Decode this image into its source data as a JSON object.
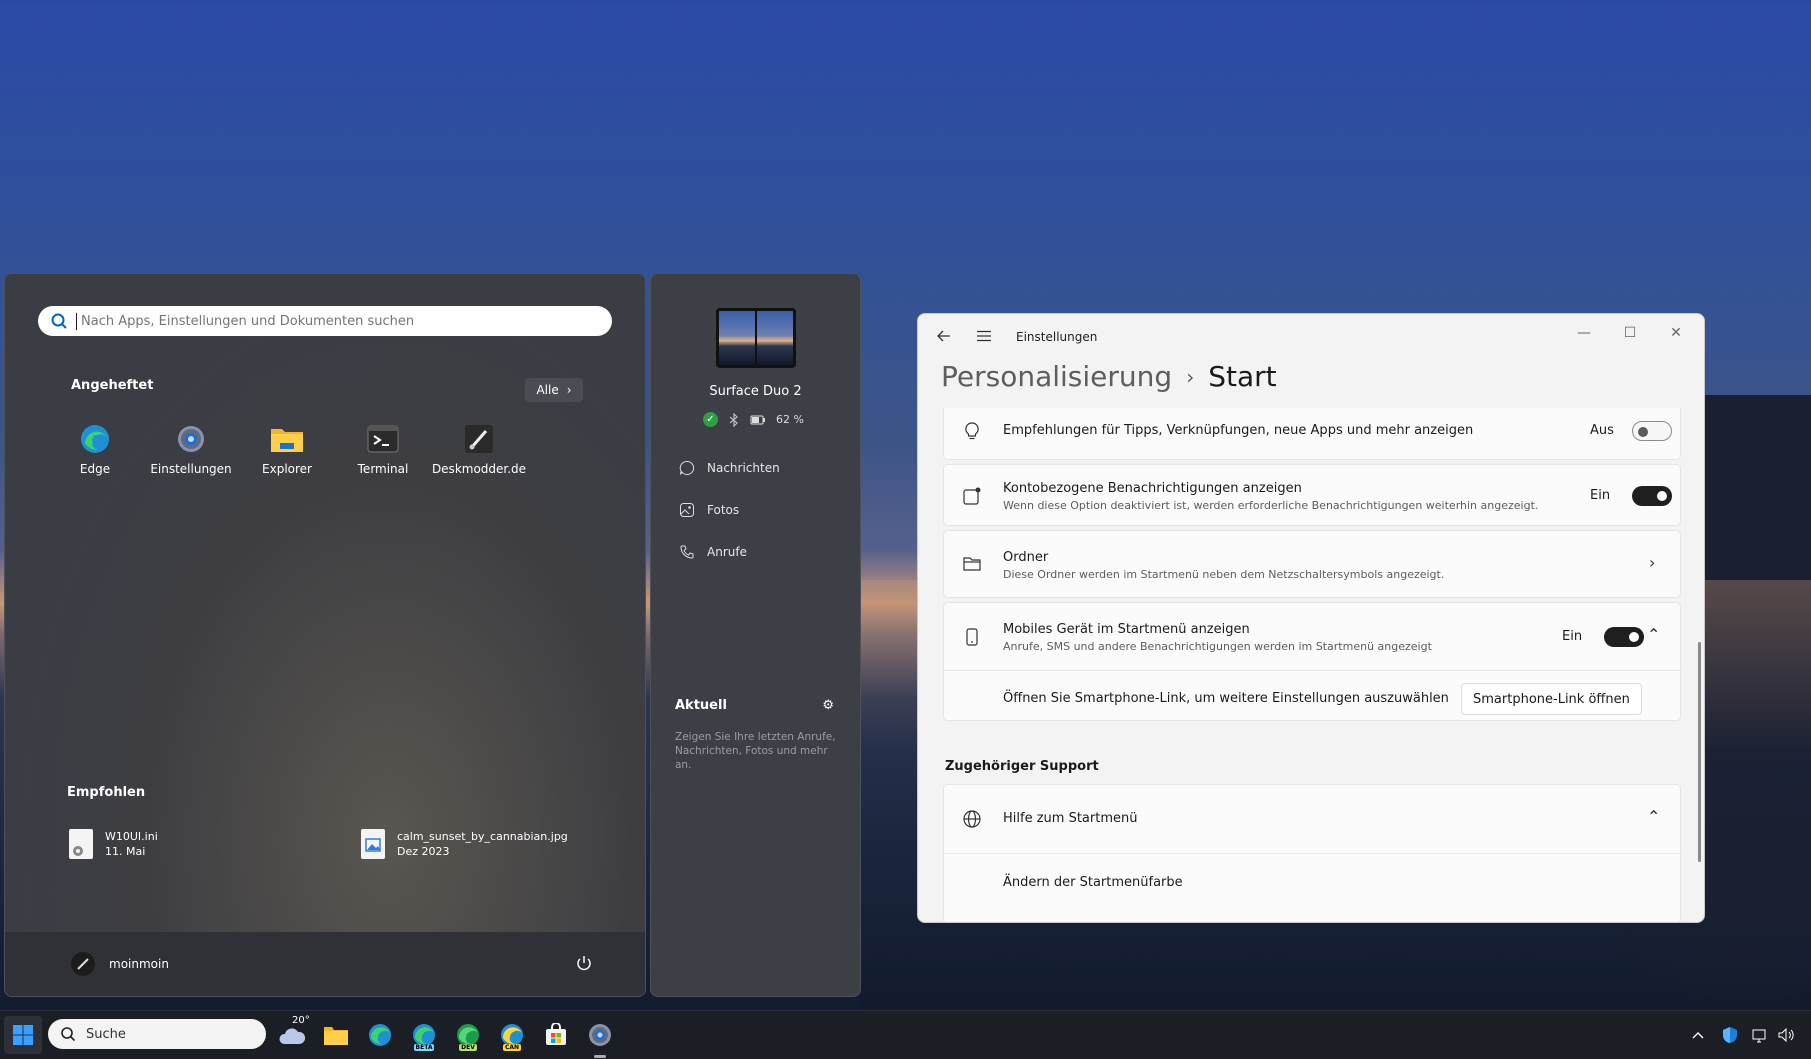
{
  "start_menu": {
    "search_placeholder": "Nach Apps, Einstellungen und Dokumenten suchen",
    "pinned_title": "Angeheftet",
    "all_label": "Alle",
    "pinned": [
      {
        "label": "Edge",
        "icon": "edge-icon"
      },
      {
        "label": "Einstellungen",
        "icon": "settings-gear-icon"
      },
      {
        "label": "Explorer",
        "icon": "folder-icon"
      },
      {
        "label": "Terminal",
        "icon": "terminal-icon"
      },
      {
        "label": "Deskmodder.de",
        "icon": "brush-icon"
      }
    ],
    "recommended_title": "Empfohlen",
    "recommended": [
      {
        "name": "W10UI.ini",
        "date": "11. Mai"
      },
      {
        "name": "calm_sunset_by_cannabian.jpg",
        "date": "Dez 2023"
      }
    ],
    "user_name": "moinmoin"
  },
  "phone_panel": {
    "device_name": "Surface Duo 2",
    "battery": "62 %",
    "items": [
      "Nachrichten",
      "Fotos",
      "Anrufe"
    ],
    "recent_title": "Aktuell",
    "recent_desc": "Zeigen Sie Ihre letzten Anrufe, Nachrichten, Fotos und mehr an."
  },
  "settings": {
    "app_title": "Einstellungen",
    "breadcrumb_parent": "Personalisierung",
    "breadcrumb_current": "Start",
    "rows": {
      "tips": {
        "title": "Empfehlungen für Tipps, Verknüpfungen, neue Apps und mehr anzeigen",
        "state": "Aus"
      },
      "account": {
        "title": "Kontobezogene Benachrichtigungen anzeigen",
        "desc": "Wenn diese Option deaktiviert ist, werden erforderliche Benachrichtigungen weiterhin angezeigt.",
        "state": "Ein"
      },
      "folders": {
        "title": "Ordner",
        "desc": "Diese Ordner werden im Startmenü neben dem Netzschaltersymbols angezeigt."
      },
      "mobile": {
        "title": "Mobiles Gerät im Startmenü anzeigen",
        "desc": "Anrufe, SMS und andere Benachrichtigungen werden im Startmenü angezeigt",
        "state": "Ein"
      },
      "phone_link": {
        "text": "Öffnen Sie Smartphone-Link, um weitere Einstellungen auszuwählen",
        "button": "Smartphone-Link öffnen"
      }
    },
    "support_title": "Zugehöriger Support",
    "help_title": "Hilfe zum Startmenü",
    "help_link": "Ändern der Startmenüfarbe"
  },
  "taskbar": {
    "search_label": "Suche",
    "weather_temp": "20°",
    "badges": [
      "BETA",
      "DEV",
      "CAN"
    ]
  },
  "colors": {
    "accent_blue": "#0078d4",
    "toggle_on": "#1f1f1f",
    "status_ok": "#2ea043"
  }
}
